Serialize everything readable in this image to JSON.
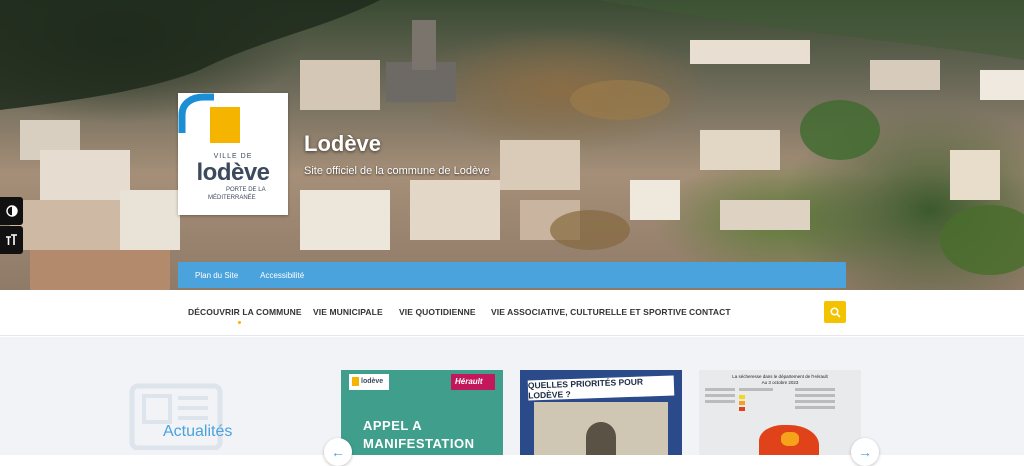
{
  "site": {
    "title": "Lodève",
    "subtitle": "Site officiel de la commune de Lodève"
  },
  "logo": {
    "ville_de": "VILLE DE",
    "name": "lodève",
    "tagline_1": "PORTE DE LA",
    "tagline_2": "MÉDITERRANÉE"
  },
  "topbar": {
    "links": [
      "Plan du Site",
      "Accessibilité"
    ]
  },
  "nav": {
    "items": [
      "DÉCOUVRIR LA COMMUNE",
      "VIE MUNICIPALE",
      "VIE QUOTIDIENNE",
      "VIE ASSOCIATIVE, CULTURELLE ET SPORTIVE",
      "CONTACT"
    ]
  },
  "news": {
    "title": "Actualités"
  },
  "cards": {
    "card1": {
      "logo_text": "lodève",
      "partner": "Hérault",
      "line1": "APPEL A",
      "line2": "MANIFESTATION"
    },
    "card2": {
      "banner": "QUELLES PRIORITÉS POUR LODÈVE ?"
    },
    "card3": {
      "head1": "La sécheresse dans le département de l'Hérault",
      "head2": "Au 3 octobre 2023"
    }
  },
  "colors": {
    "accent_blue": "#4aa3dd",
    "accent_yellow": "#f4c300",
    "logo_yellow": "#f4b400"
  },
  "icons": {
    "contrast": "contrast-icon",
    "text_size": "text-size-icon",
    "search": "search-icon",
    "arrow_left": "arrow-left-icon",
    "arrow_right": "arrow-right-icon"
  }
}
